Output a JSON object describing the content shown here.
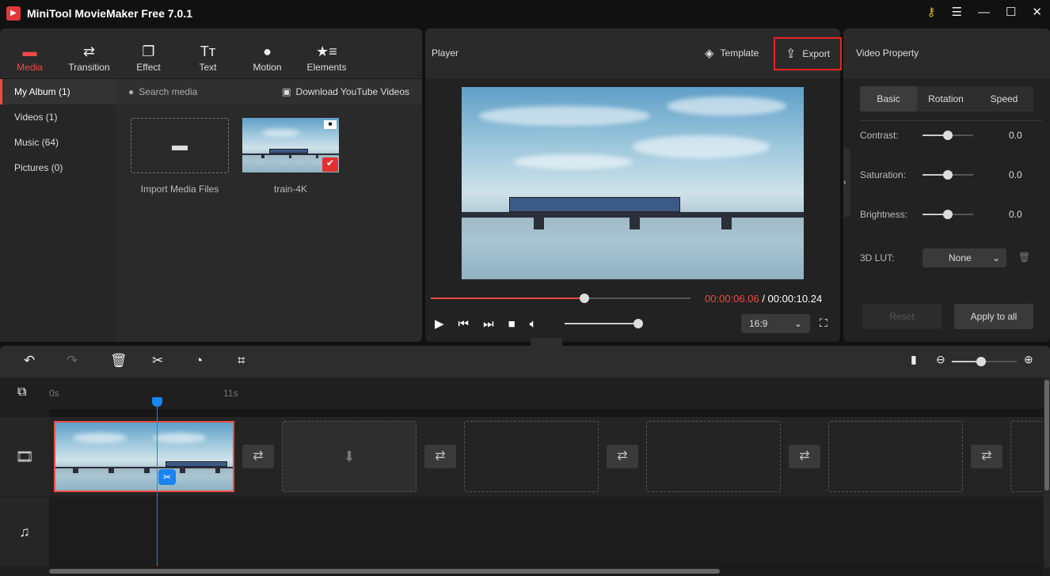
{
  "window": {
    "title": "MiniTool MovieMaker Free 7.0.1"
  },
  "toolbar": {
    "tabs": [
      {
        "label": "Media",
        "icon": "folder-icon",
        "active": true
      },
      {
        "label": "Transition",
        "icon": "transition-icon"
      },
      {
        "label": "Effect",
        "icon": "effect-icon"
      },
      {
        "label": "Text",
        "icon": "text-icon"
      },
      {
        "label": "Motion",
        "icon": "motion-icon"
      },
      {
        "label": "Elements",
        "icon": "elements-icon"
      }
    ]
  },
  "sidebar": {
    "items": [
      {
        "label": "My Album (1)",
        "active": true
      },
      {
        "label": "Videos (1)"
      },
      {
        "label": "Music (64)"
      },
      {
        "label": "Pictures (0)"
      }
    ]
  },
  "media": {
    "search_placeholder": "Search media",
    "download_label": "Download YouTube Videos",
    "import_label": "Import Media Files",
    "items": [
      {
        "name": "train-4K",
        "selected": true
      }
    ]
  },
  "player": {
    "title": "Player",
    "template_label": "Template",
    "export_label": "Export",
    "current_time": "00:00:06.06",
    "total_time": "/ 00:00:10.24",
    "progress_percent": 59,
    "volume_percent": 100,
    "aspect_ratio": "16:9",
    "tooltip": "Stop"
  },
  "property": {
    "title": "Video Property",
    "tabs": [
      "Basic",
      "Rotation",
      "Speed"
    ],
    "active_tab": "Basic",
    "sliders": [
      {
        "label": "Contrast:",
        "value": "0.0",
        "percent": 50
      },
      {
        "label": "Saturation:",
        "value": "0.0",
        "percent": 50
      },
      {
        "label": "Brightness:",
        "value": "0.0",
        "percent": 50
      }
    ],
    "lut_label": "3D LUT:",
    "lut_value": "None",
    "reset_label": "Reset",
    "apply_label": "Apply to all"
  },
  "timeline": {
    "ruler": [
      "0s",
      "11s"
    ],
    "zoom_percent": 45
  },
  "colors": {
    "accent": "#f04b44",
    "playhead": "#1a84f0",
    "export_highlight": "#e8231f"
  }
}
